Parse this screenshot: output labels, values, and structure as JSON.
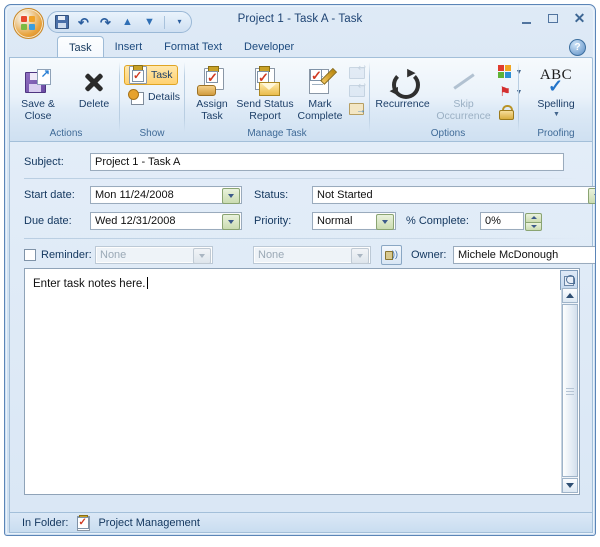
{
  "window": {
    "title": "Project 1 - Task A - Task",
    "orb_name": "office-button",
    "quick_access": [
      {
        "name": "save",
        "icon": "save-icon"
      },
      {
        "name": "undo",
        "icon": "undo-icon",
        "glyph": "↶"
      },
      {
        "name": "redo",
        "icon": "redo-icon",
        "glyph": "↷"
      },
      {
        "name": "previous-item",
        "icon": "previous-item-icon",
        "glyph": "▲"
      },
      {
        "name": "next-item",
        "icon": "next-item-icon",
        "glyph": "▼"
      },
      {
        "name": "customize-quick-access",
        "icon": "chevron-down-icon",
        "glyph": "▾"
      }
    ],
    "controls": {
      "minimize": "minimize-button",
      "maximize": "maximize-button",
      "close": "close-button",
      "help": "?"
    }
  },
  "ribbon": {
    "tabs": [
      {
        "label": "Task",
        "active": true
      },
      {
        "label": "Insert",
        "active": false
      },
      {
        "label": "Format Text",
        "active": false
      },
      {
        "label": "Developer",
        "active": false
      }
    ],
    "groups": [
      {
        "label": "Actions",
        "buttons": [
          {
            "label_line1": "Save &",
            "label_line2": "Close",
            "icon": "save-and-close-icon"
          },
          {
            "label_line1": "Delete",
            "label_line2": "",
            "icon": "delete-icon"
          }
        ]
      },
      {
        "label": "Show",
        "buttons": [
          {
            "label_line1": "Task",
            "icon": "task-form-icon",
            "selected": true
          },
          {
            "label_line1": "Details",
            "icon": "task-details-icon",
            "selected": false
          }
        ]
      },
      {
        "label": "Manage Task",
        "buttons": [
          {
            "label_line1": "Assign",
            "label_line2": "Task",
            "icon": "assign-task-icon"
          },
          {
            "label_line1": "Send Status",
            "label_line2": "Report",
            "icon": "send-status-report-icon"
          },
          {
            "label_line1": "Mark",
            "label_line2": "Complete",
            "icon": "mark-complete-icon"
          }
        ],
        "small_buttons": [
          {
            "icon": "reply-icon",
            "disabled": true
          },
          {
            "icon": "reply-all-icon",
            "disabled": true
          },
          {
            "icon": "forward-icon",
            "disabled": false
          }
        ]
      },
      {
        "label": "Options",
        "buttons": [
          {
            "label_line1": "Recurrence",
            "label_line2": "",
            "icon": "recurrence-icon",
            "disabled": false
          },
          {
            "label_line1": "Skip",
            "label_line2": "Occurrence",
            "icon": "skip-occurrence-icon",
            "disabled": true
          }
        ],
        "small_buttons": [
          {
            "icon": "categorize-icon",
            "has_caret": true
          },
          {
            "icon": "follow-up-flag-icon",
            "has_caret": true
          },
          {
            "icon": "private-lock-icon",
            "has_caret": false
          }
        ]
      },
      {
        "label": "Proofing",
        "buttons": [
          {
            "label_line1": "Spelling",
            "label_line2": "",
            "icon": "spelling-icon",
            "has_caret": true
          }
        ]
      }
    ]
  },
  "form": {
    "subject": {
      "label": "Subject:",
      "value": "Project 1 - Task A"
    },
    "start_date": {
      "label": "Start date:",
      "value": "Mon 11/24/2008"
    },
    "due_date": {
      "label": "Due date:",
      "value": "Wed 12/31/2008"
    },
    "status": {
      "label": "Status:",
      "value": "Not Started"
    },
    "priority": {
      "label": "Priority:",
      "value": "Normal"
    },
    "percent_complete": {
      "label": "% Complete:",
      "value": "0%"
    },
    "reminder": {
      "label": "Reminder:",
      "checked": false,
      "date_value": "None",
      "time_value": "None",
      "sound_icon": "reminder-sound-icon"
    },
    "owner": {
      "label": "Owner:",
      "value": "Michele McDonough"
    }
  },
  "notes": {
    "text": "Enter task notes here.",
    "attach_icon": "attachment-icon"
  },
  "statusbar": {
    "label": "In Folder:",
    "folder_icon": "task-folder-icon",
    "folder_name": "Project Management"
  }
}
